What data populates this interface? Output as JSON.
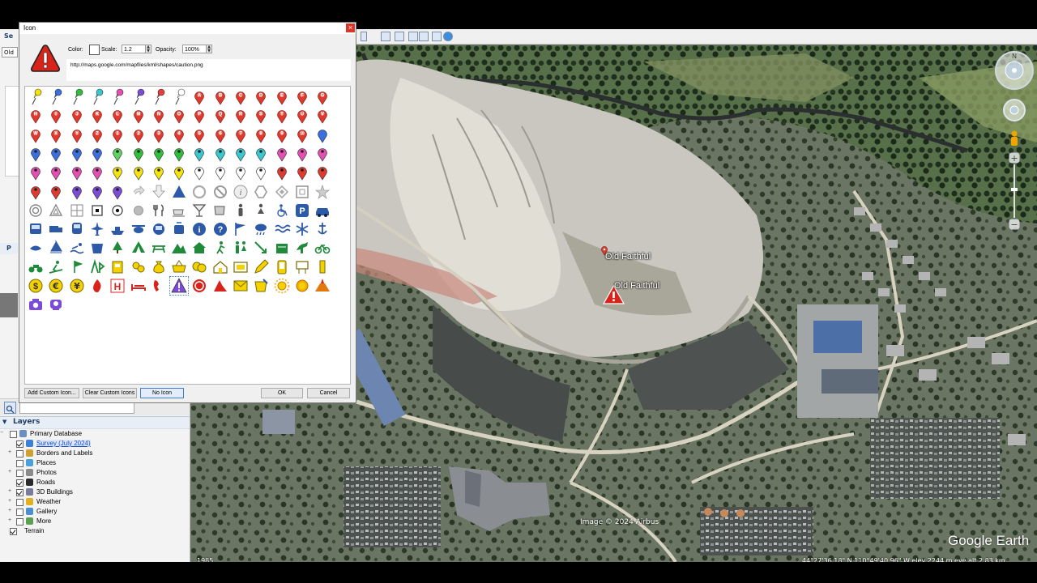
{
  "dialog": {
    "title": "Icon",
    "close_glyph": "×",
    "color_label": "Color:",
    "scale_label": "Scale:",
    "scale_value": "1.2",
    "opacity_label": "Opacity:",
    "opacity_value": "100%",
    "url": "http://maps.google.com/mapfiles/kml/shapes/caution.png",
    "buttons": {
      "add_custom": "Add Custom Icon...",
      "clear_custom": "Clear Custom Icons",
      "no_icon": "No Icon",
      "ok": "OK",
      "cancel": "Cancel"
    },
    "icon_grid": {
      "pushpin_colors": [
        "#f4e30d",
        "#3b6fe0",
        "#2fbf3a",
        "#39c8d0",
        "#e54fb2",
        "#7a4bd6",
        "#e53c3c",
        "#ffffff"
      ],
      "letter_paddles": [
        "A",
        "B",
        "C",
        "D",
        "E",
        "F",
        "G",
        "H",
        "I",
        "J",
        "K",
        "L",
        "M",
        "N",
        "O",
        "P",
        "Q",
        "R",
        "S",
        "T",
        "U",
        "V",
        "W",
        "X",
        "Y",
        "Z",
        "1",
        "2",
        "3",
        "4",
        "5",
        "6",
        "7",
        "8",
        "9",
        "10"
      ],
      "paddle_color": "#e03a2e",
      "row_colors": {
        "row4": [
          "#3b6fe0",
          "#3b6fe0",
          "#3b6fe0",
          "#3b6fe0",
          "#5fd35f",
          "#2fbf3a",
          "#2fbf3a",
          "#2fbf3a",
          "#39c8d0",
          "#39c8d0",
          "#39c8d0",
          "#39c8d0",
          "#e54fb2",
          "#e54fb2",
          "#e54fb2"
        ],
        "row5": [
          "#e54fb2",
          "#e54fb2",
          "#e54fb2",
          "#e54fb2",
          "#f4e30d",
          "#f4e30d",
          "#f4e30d",
          "#f4e30d",
          "#ffffff",
          "#ffffff",
          "#ffffff",
          "#ffffff",
          "#e03a2e",
          "#e03a2e",
          "#e03a2e"
        ],
        "row6": [
          "#e03a2e",
          "#e03a2e",
          "#7a4bd6",
          "#7a4bd6",
          "#7a4bd6"
        ]
      },
      "selected_icon": "caution-icon"
    }
  },
  "map": {
    "labels": [
      "Old Faithful",
      "Old Faithful"
    ],
    "attribution": "Image © 2024 Airbus",
    "brand": "Google Earth",
    "status": "44°27'36.18\" N  110°49'40.96\" W  elev 2244 m   eye alt  2.83 km",
    "tour_year": "1985"
  },
  "left_panel": {
    "search_tab": "Se",
    "search_value": "Old F",
    "places_tab": "P",
    "layers_title": "Layers",
    "layers": [
      {
        "label": "Primary Database",
        "checked": false,
        "indent": 0,
        "expand": "−",
        "icon": "database-icon"
      },
      {
        "label": "Survey (July 2024)",
        "checked": true,
        "indent": 1,
        "expand": "",
        "icon": "survey-icon",
        "link": true
      },
      {
        "label": "Borders and Labels",
        "checked": false,
        "indent": 1,
        "expand": "+",
        "icon": "borders-icon"
      },
      {
        "label": "Places",
        "checked": false,
        "indent": 1,
        "expand": "",
        "icon": "places-icon"
      },
      {
        "label": "Photos",
        "checked": false,
        "indent": 1,
        "expand": "+",
        "icon": "photos-icon"
      },
      {
        "label": "Roads",
        "checked": true,
        "indent": 1,
        "expand": "",
        "icon": "roads-icon"
      },
      {
        "label": "3D Buildings",
        "checked": true,
        "indent": 1,
        "expand": "+",
        "icon": "buildings-icon"
      },
      {
        "label": "Weather",
        "checked": false,
        "indent": 1,
        "expand": "+",
        "icon": "weather-icon"
      },
      {
        "label": "Gallery",
        "checked": false,
        "indent": 1,
        "expand": "+",
        "icon": "gallery-icon"
      },
      {
        "label": "More",
        "checked": false,
        "indent": 1,
        "expand": "+",
        "icon": "more-icon"
      },
      {
        "label": "Terrain",
        "checked": true,
        "indent": 0,
        "expand": "",
        "icon": ""
      }
    ]
  },
  "colors": {
    "caution_red": "#d8231b",
    "accent_blue": "#3c7fd6",
    "map_ground": "#6f7a68"
  }
}
